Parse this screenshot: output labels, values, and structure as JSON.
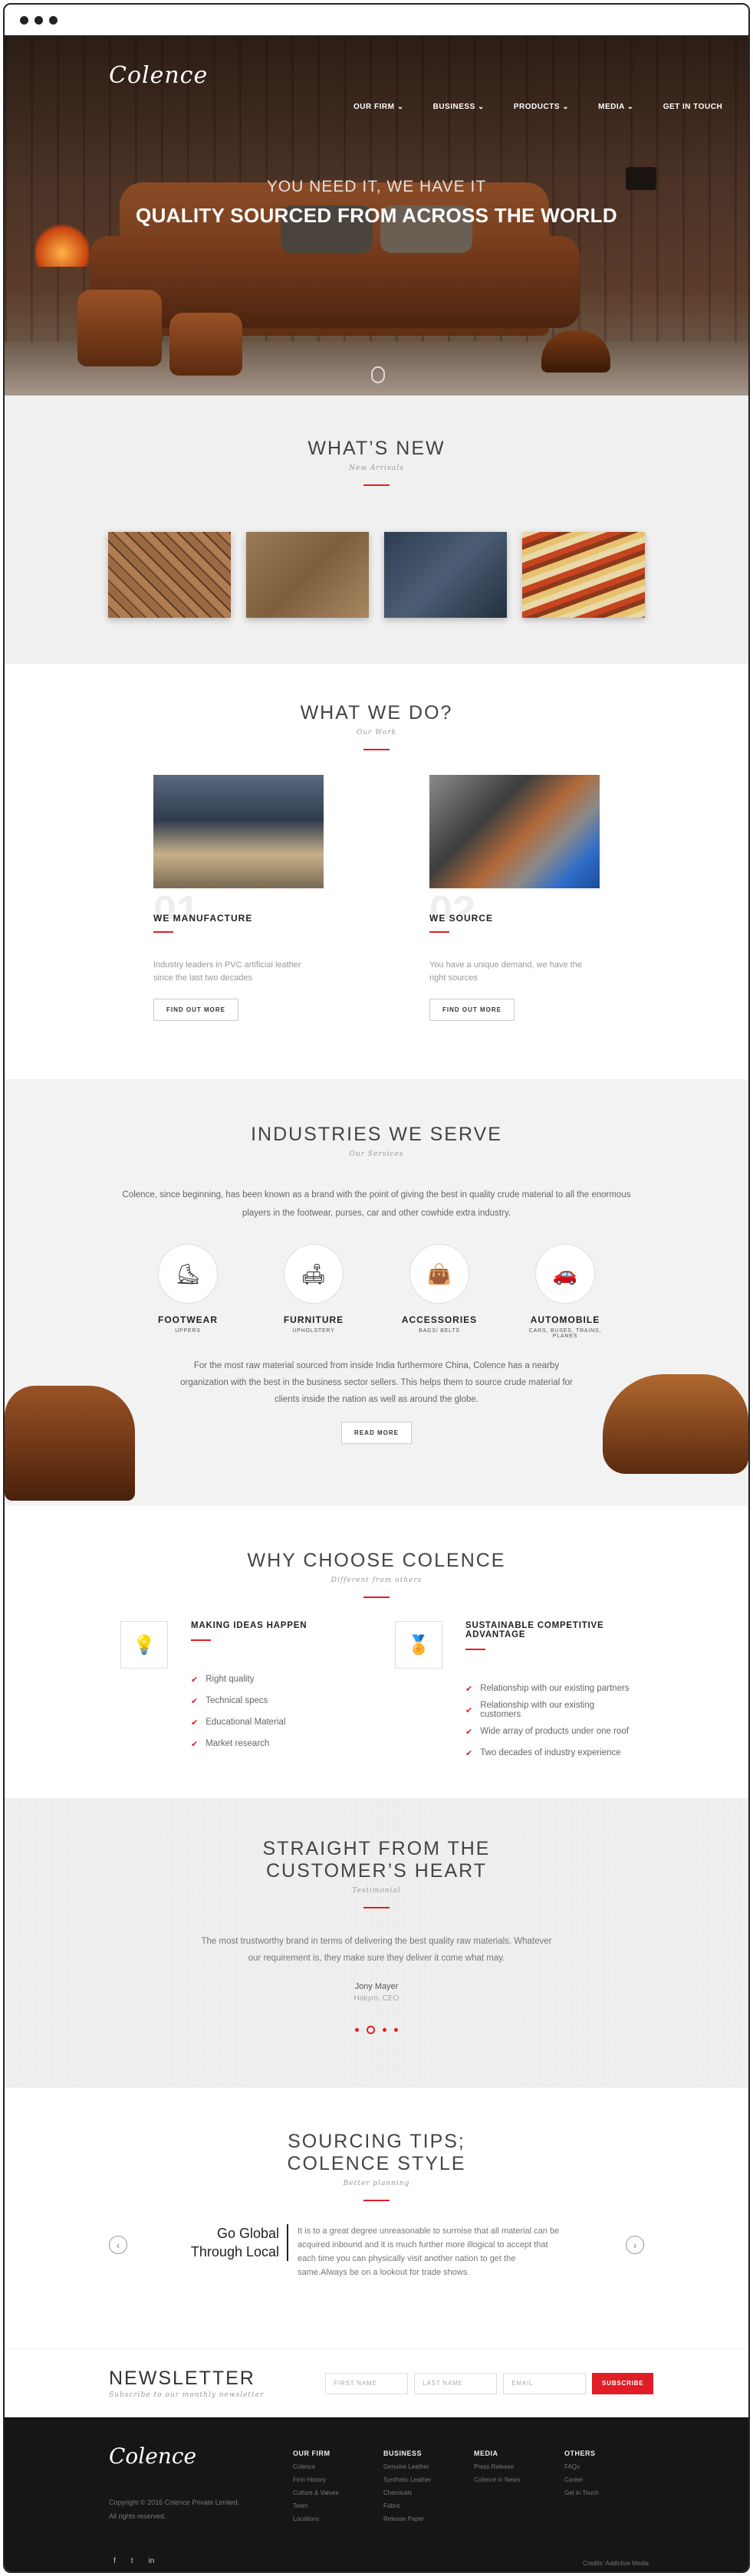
{
  "brand": {
    "logo": "Colence",
    "accent": "#e01e26"
  },
  "nav": {
    "items": [
      "OUR FIRM ⌄",
      "BUSINESS ⌄",
      "PRODUCTS ⌄",
      "MEDIA ⌄",
      "GET IN TOUCH"
    ]
  },
  "hero": {
    "line1": "YOU NEED IT, WE HAVE IT",
    "line2": "QUALITY SOURCED FROM ACROSS THE WORLD"
  },
  "whats_new": {
    "title": "WHAT’S NEW",
    "subtitle": "New Arrivals"
  },
  "what_we_do": {
    "title": "WHAT WE DO?",
    "subtitle": "Our Work",
    "items": [
      {
        "num": "01",
        "title": "WE MANUFACTURE",
        "text": "Industry leaders in PVC artificial leather since the last two decades",
        "button": "FIND OUT MORE"
      },
      {
        "num": "02",
        "title": "WE SOURCE",
        "text": "You have a unique demand, we have the right sources",
        "button": "FIND OUT MORE"
      }
    ]
  },
  "industries": {
    "title": "INDUSTRIES WE SERVE",
    "subtitle": "Our Services",
    "intro": "Colence, since beginning, has been known as a brand with the point of giving the best in quality crude material to all the enormous players in the footwear, purses, car and other cowhide extra industry.",
    "items": [
      {
        "name": "FOOTWEAR",
        "sub": "UPPERS",
        "icon": "shoe-icon"
      },
      {
        "name": "FURNITURE",
        "sub": "UPHOLSTERY",
        "icon": "sofa-icon"
      },
      {
        "name": "ACCESSORIES",
        "sub": "BAGS/ BELTS",
        "icon": "bag-icon"
      },
      {
        "name": "AUTOMOBILE",
        "sub": "CARS, BUSES, TRAINS, PLANES",
        "icon": "car-icon"
      }
    ],
    "para": "For the most raw material sourced from inside India furthermore China, Colence has a nearby organization with the best in the business sector sellers. This helps them to source crude material for clients inside the nation as well as around the globe.",
    "button": "READ MORE"
  },
  "why": {
    "title": "WHY CHOOSE COLENCE",
    "subtitle": "Different from others",
    "left": {
      "title": "MAKING IDEAS HAPPEN",
      "items": [
        "Right quality",
        "Technical specs",
        "Educational Material",
        "Market research"
      ]
    },
    "right": {
      "title": "SUSTAINABLE COMPETITIVE ADVANTAGE",
      "items": [
        "Relationship with our existing partners",
        "Relationship with our existing customers",
        "Wide array of products under one roof",
        "Two decades of industry experience"
      ]
    }
  },
  "testimonial": {
    "title_1": "STRAIGHT FROM THE",
    "title_2": "CUSTOMER’S HEART",
    "subtitle": "Testimonial",
    "quote": "The most trustworthy brand in terms of delivering the best quality raw materials. Whatever our requirement is, they make sure they deliver it come what may.",
    "name": "Jony Mayer",
    "role": "Hakyro, CEO"
  },
  "tips": {
    "title_1": "SOURCING TIPS;",
    "title_2": "COLENCE STYLE",
    "subtitle": "Better planning",
    "head": "Go Global Through Local",
    "text": "It is to a great degree unreasonable to surmise that all material can be acquired inbound and it is much further more illogical to accept that each time you can physically visit another nation to get the same.Always be on a lookout for trade shows."
  },
  "newsletter": {
    "title": "NEWSLETTER",
    "subtitle": "Subscribe to our monthly newsletter",
    "first": "FIRST NAME",
    "last": "LAST NAME",
    "email": "EMAIL",
    "button": "SUBSCRIBE"
  },
  "footer": {
    "copy_1": "Copyright © 2016 Colence Private Limited.",
    "copy_2": "All rights reserved.",
    "credits": "Credits: Addictive Media",
    "social": [
      "f",
      "t",
      "in"
    ],
    "cols": [
      {
        "title": "OUR FIRM",
        "items": [
          "Colence",
          "Firm History",
          "Culture & Values",
          "Team",
          "Locations"
        ]
      },
      {
        "title": "BUSINESS",
        "items": [
          "Genuine Leather",
          "Synthetic Leather",
          "Chemicals",
          "Fabric",
          "Release Paper"
        ]
      },
      {
        "title": "MEDIA",
        "items": [
          "Press Release",
          "Colence in News"
        ]
      },
      {
        "title": "OTHERS",
        "items": [
          "FAQs",
          "Career",
          "Get in Touch"
        ]
      }
    ]
  }
}
